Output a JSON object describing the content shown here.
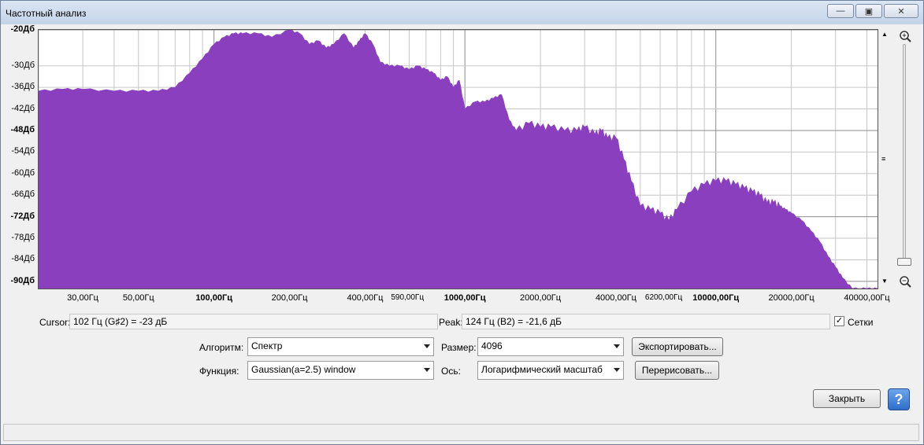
{
  "window": {
    "title": "Частотный анализ"
  },
  "chart_data": {
    "type": "area",
    "title": "",
    "ylabels": [
      {
        "text": "-20Дб",
        "bold": true
      },
      {
        "text": "-30Дб",
        "bold": false
      },
      {
        "text": "-36Дб",
        "bold": false
      },
      {
        "text": "-42Дб",
        "bold": false
      },
      {
        "text": "-48Дб",
        "bold": true
      },
      {
        "text": "-54Дб",
        "bold": false
      },
      {
        "text": "-60Дб",
        "bold": false
      },
      {
        "text": "-66Дб",
        "bold": false
      },
      {
        "text": "-72Дб",
        "bold": true
      },
      {
        "text": "-78Дб",
        "bold": false
      },
      {
        "text": "-84Дб",
        "bold": false
      },
      {
        "text": "-90Дб",
        "bold": true
      }
    ],
    "ydb": [
      -20,
      -30,
      -36,
      -42,
      -48,
      -54,
      -60,
      -66,
      -72,
      -78,
      -84,
      -90
    ],
    "ylim": [
      -20,
      -92
    ],
    "xlabels": [
      {
        "text": "30,00Гц",
        "f": 30,
        "bold": false
      },
      {
        "text": "50,00Гц",
        "f": 50,
        "bold": false
      },
      {
        "text": "100,00Гц",
        "f": 100,
        "bold": true
      },
      {
        "text": "200,00Гц",
        "f": 200,
        "bold": false
      },
      {
        "text": "400,00Гц",
        "f": 400,
        "bold": false
      },
      {
        "text": "590,00Гц",
        "f": 590,
        "bold": false
      },
      {
        "text": "1000,00Гц",
        "f": 1000,
        "bold": true
      },
      {
        "text": "2000,00Гц",
        "f": 2000,
        "bold": false
      },
      {
        "text": "4000,00Гц",
        "f": 4000,
        "bold": false
      },
      {
        "text": "6200,00Гц",
        "f": 6200,
        "bold": false
      },
      {
        "text": "10000,00Гц",
        "f": 10000,
        "bold": true
      },
      {
        "text": "20000,00Гц",
        "f": 20000,
        "bold": false
      },
      {
        "text": "40000,00Гц",
        "f": 40000,
        "bold": false
      }
    ],
    "xlim": [
      20,
      44100
    ],
    "x_scale": "log",
    "grid": true,
    "fill_color": "#8a3fbe",
    "series": [
      {
        "x": [
          20,
          25,
          30,
          40,
          50,
          60,
          70,
          80,
          90,
          100,
          110,
          120,
          130,
          150,
          170,
          200,
          220,
          240,
          260,
          280,
          300,
          330,
          360,
          380,
          400,
          430,
          460,
          500,
          550,
          600,
          650,
          700,
          750,
          800,
          850,
          900,
          950,
          1000,
          1100,
          1200,
          1300,
          1400,
          1500,
          1600,
          1800,
          2000,
          2200,
          2500,
          2800,
          3000,
          3300,
          3500,
          3700,
          4000,
          4300,
          4600,
          5000,
          5500,
          6000,
          6500,
          7000,
          8000,
          9000,
          10000,
          11000,
          12000,
          13000,
          14000,
          15000,
          16000,
          17000,
          18000,
          19000,
          20000,
          22000,
          24000,
          26000,
          28000,
          30000,
          32000,
          35000,
          40000,
          44100
        ],
        "y": [
          -37,
          -36.5,
          -36.5,
          -37,
          -37,
          -37,
          -36,
          -32,
          -28,
          -24,
          -22,
          -21,
          -21,
          -21,
          -22,
          -20,
          -21,
          -24,
          -23,
          -25,
          -24,
          -21,
          -25,
          -23,
          -21,
          -24,
          -29,
          -30,
          -30,
          -31,
          -30,
          -31,
          -32,
          -34,
          -33,
          -36,
          -34,
          -42,
          -40,
          -40,
          -39,
          -38,
          -45,
          -48,
          -46,
          -47,
          -47,
          -48,
          -48,
          -47,
          -49,
          -48,
          -50,
          -50,
          -56,
          -62,
          -69,
          -70,
          -71,
          -73,
          -70,
          -65,
          -63,
          -62,
          -62,
          -63,
          -64,
          -65,
          -66,
          -68,
          -68,
          -69,
          -70,
          -71,
          -73,
          -76,
          -79,
          -83,
          -86,
          -89,
          -92,
          -92,
          -92
        ],
        "name": ""
      }
    ]
  },
  "info": {
    "cursor_label": "Cursor:",
    "cursor_value": "102 Гц (G♯2) = -23 дБ",
    "peak_label": "Peak:",
    "peak_value": "124 Гц (B2) = -21,6 дБ",
    "grid_label": "Сетки",
    "grid_checked": true
  },
  "controls": {
    "algorithm_label": "Алгоритм:",
    "algorithm_value": "Спектр",
    "function_label": "Функция:",
    "function_value": "Gaussian(a=2.5) window",
    "size_label": "Размер:",
    "size_value": "4096",
    "axis_label": "Ось:",
    "axis_value": "Логарифмический масштаб",
    "export_label": "Экспортировать...",
    "redraw_label": "Перерисовать...",
    "close_label": "Закрыть",
    "help_label": "?"
  },
  "icons": {
    "zoom_in": "zoom-in-icon",
    "zoom_out": "zoom-out-icon"
  }
}
